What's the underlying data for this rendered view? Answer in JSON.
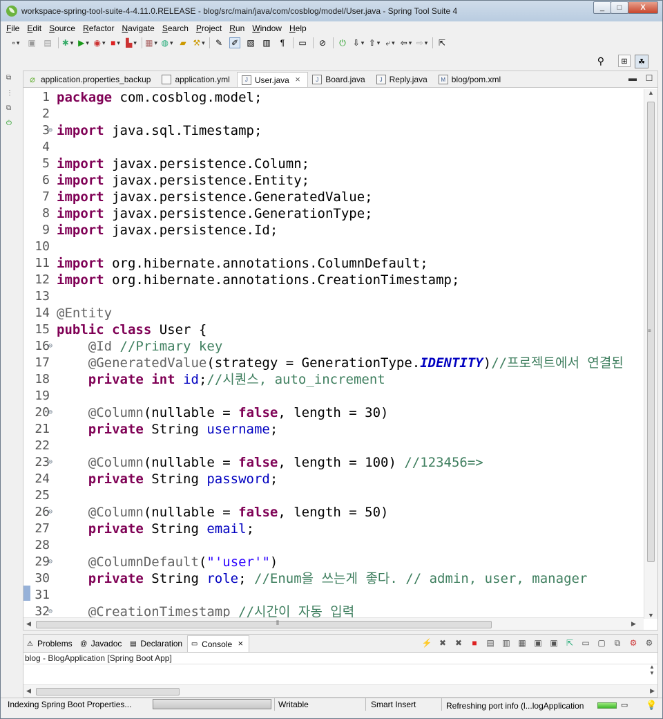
{
  "window": {
    "title": "workspace-spring-tool-suite-4-4.11.0.RELEASE - blog/src/main/java/com/cosblog/model/User.java - Spring Tool Suite 4",
    "controls": [
      "_",
      "□",
      "X"
    ]
  },
  "menu": [
    "File",
    "Edit",
    "Source",
    "Refactor",
    "Navigate",
    "Search",
    "Project",
    "Run",
    "Window",
    "Help"
  ],
  "editor_tabs": [
    {
      "label": "application.properties_backup",
      "icon": "properties-file-icon",
      "active": false
    },
    {
      "label": "application.yml",
      "icon": "yaml-file-icon",
      "active": false
    },
    {
      "label": "User.java",
      "icon": "java-file-icon",
      "active": true
    },
    {
      "label": "Board.java",
      "icon": "java-file-icon",
      "active": false
    },
    {
      "label": "Reply.java",
      "icon": "java-file-icon",
      "active": false
    },
    {
      "label": "blog/pom.xml",
      "icon": "maven-pom-icon",
      "active": false
    }
  ],
  "code": [
    {
      "n": "1",
      "fold": "",
      "tokens": [
        [
          "kw",
          "package"
        ],
        [
          "",
          "com.cosblog.model;"
        ]
      ]
    },
    {
      "n": "2",
      "fold": "",
      "tokens": []
    },
    {
      "n": "3",
      "fold": "⊖",
      "tokens": [
        [
          "kw",
          "import"
        ],
        [
          "",
          "java.sql.Timestamp;"
        ]
      ]
    },
    {
      "n": "4",
      "fold": "",
      "tokens": []
    },
    {
      "n": "5",
      "fold": "",
      "tokens": [
        [
          "kw",
          "import"
        ],
        [
          "",
          "javax.persistence.Column;"
        ]
      ]
    },
    {
      "n": "6",
      "fold": "",
      "tokens": [
        [
          "kw",
          "import"
        ],
        [
          "",
          "javax.persistence.Entity;"
        ]
      ]
    },
    {
      "n": "7",
      "fold": "",
      "tokens": [
        [
          "kw",
          "import"
        ],
        [
          "",
          "javax.persistence.GeneratedValue;"
        ]
      ]
    },
    {
      "n": "8",
      "fold": "",
      "tokens": [
        [
          "kw",
          "import"
        ],
        [
          "",
          "javax.persistence.GenerationType;"
        ]
      ]
    },
    {
      "n": "9",
      "fold": "",
      "tokens": [
        [
          "kw",
          "import"
        ],
        [
          "",
          "javax.persistence.Id;"
        ]
      ]
    },
    {
      "n": "10",
      "fold": "",
      "tokens": []
    },
    {
      "n": "11",
      "fold": "",
      "tokens": [
        [
          "kw",
          "import"
        ],
        [
          "",
          "org.hibernate.annotations.ColumnDefault;"
        ]
      ]
    },
    {
      "n": "12",
      "fold": "",
      "tokens": [
        [
          "kw",
          "import"
        ],
        [
          "",
          "org.hibernate.annotations.CreationTimestamp;"
        ]
      ]
    },
    {
      "n": "13",
      "fold": "",
      "tokens": []
    },
    {
      "n": "14",
      "fold": "",
      "tokens": [
        [
          "ann",
          "@Entity"
        ]
      ]
    },
    {
      "n": "15",
      "fold": "",
      "tokens": [
        [
          "kw",
          "public class"
        ],
        [
          "",
          " User {"
        ]
      ]
    },
    {
      "n": "16",
      "fold": "⊖",
      "tokens": [
        [
          "",
          "    "
        ],
        [
          "ann",
          "@Id"
        ],
        [
          "",
          " "
        ],
        [
          "cm",
          "//Primary key"
        ]
      ]
    },
    {
      "n": "17",
      "fold": "",
      "tokens": [
        [
          "",
          "    "
        ],
        [
          "ann",
          "@GeneratedValue"
        ],
        [
          "",
          "(strategy = GenerationType."
        ],
        [
          "en",
          "IDENTITY"
        ],
        [
          "",
          ")"
        ],
        [
          "cm",
          "//프로젝트에서 연결된"
        ]
      ]
    },
    {
      "n": "18",
      "fold": "",
      "tokens": [
        [
          "",
          "    "
        ],
        [
          "kw",
          "private int"
        ],
        [
          "",
          " "
        ],
        [
          "fld",
          "id"
        ],
        [
          "",
          ";"
        ],
        [
          "cm",
          "//시퀀스, auto_increment"
        ]
      ]
    },
    {
      "n": "19",
      "fold": "",
      "tokens": []
    },
    {
      "n": "20",
      "fold": "⊖",
      "tokens": [
        [
          "",
          "    "
        ],
        [
          "ann",
          "@Column"
        ],
        [
          "",
          "(nullable = "
        ],
        [
          "kw",
          "false"
        ],
        [
          "",
          ", length = 30)"
        ]
      ]
    },
    {
      "n": "21",
      "fold": "",
      "tokens": [
        [
          "",
          "    "
        ],
        [
          "kw",
          "private"
        ],
        [
          "",
          " String "
        ],
        [
          "fld",
          "username"
        ],
        [
          "",
          ";"
        ]
      ]
    },
    {
      "n": "22",
      "fold": "",
      "tokens": []
    },
    {
      "n": "23",
      "fold": "⊖",
      "tokens": [
        [
          "",
          "    "
        ],
        [
          "ann",
          "@Column"
        ],
        [
          "",
          "(nullable = "
        ],
        [
          "kw",
          "false"
        ],
        [
          "",
          ", length = 100) "
        ],
        [
          "cm",
          "//123456=>"
        ]
      ]
    },
    {
      "n": "24",
      "fold": "",
      "tokens": [
        [
          "",
          "    "
        ],
        [
          "kw",
          "private"
        ],
        [
          "",
          " String "
        ],
        [
          "fld",
          "password"
        ],
        [
          "",
          ";"
        ]
      ]
    },
    {
      "n": "25",
      "fold": "",
      "tokens": []
    },
    {
      "n": "26",
      "fold": "⊖",
      "tokens": [
        [
          "",
          "    "
        ],
        [
          "ann",
          "@Column"
        ],
        [
          "",
          "(nullable = "
        ],
        [
          "kw",
          "false"
        ],
        [
          "",
          ", length = 50)"
        ]
      ]
    },
    {
      "n": "27",
      "fold": "",
      "tokens": [
        [
          "",
          "    "
        ],
        [
          "kw",
          "private"
        ],
        [
          "",
          " String "
        ],
        [
          "fld",
          "email"
        ],
        [
          "",
          ";"
        ]
      ]
    },
    {
      "n": "28",
      "fold": "",
      "tokens": []
    },
    {
      "n": "29",
      "fold": "⊖",
      "tokens": [
        [
          "",
          "    "
        ],
        [
          "ann",
          "@ColumnDefault"
        ],
        [
          "",
          "("
        ],
        [
          "str",
          "\"'user'\""
        ],
        [
          "",
          ")"
        ]
      ]
    },
    {
      "n": "30",
      "fold": "",
      "tokens": [
        [
          "",
          "    "
        ],
        [
          "kw",
          "private"
        ],
        [
          "",
          " String "
        ],
        [
          "fld",
          "role"
        ],
        [
          "",
          "; "
        ],
        [
          "cm",
          "//Enum을 쓰는게 좋다. // admin, user, manager"
        ]
      ]
    },
    {
      "n": "31",
      "fold": "",
      "tokens": []
    },
    {
      "n": "32",
      "fold": "⊖",
      "tokens": [
        [
          "",
          "    "
        ],
        [
          "ann",
          "@CreationTimestamp"
        ],
        [
          "",
          " "
        ],
        [
          "cm",
          "//시간이 자동 입력"
        ]
      ]
    }
  ],
  "bottom_tabs": [
    {
      "label": "Problems",
      "icon": "problems-icon",
      "active": false
    },
    {
      "label": "Javadoc",
      "icon": "javadoc-icon",
      "active": false
    },
    {
      "label": "Declaration",
      "icon": "declaration-icon",
      "active": false
    },
    {
      "label": "Console",
      "icon": "console-icon",
      "active": true
    }
  ],
  "console": {
    "label": "blog - BlogApplication [Spring Boot App]"
  },
  "status": {
    "indexing": "Indexing Spring Boot Properties...",
    "writable": "Writable",
    "insert_mode": "Smart Insert",
    "refresh": "Refreshing port info (l...logApplication"
  }
}
